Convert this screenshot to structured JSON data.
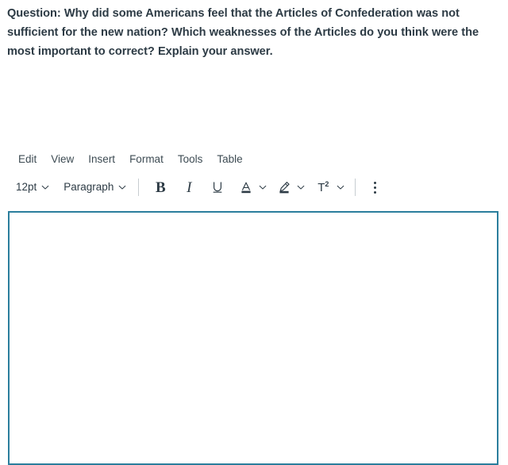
{
  "question": {
    "label": "question-prompt",
    "text": "Question:  Why did some Americans feel that the Articles of Confederation was not sufficient for the new nation?  Which weaknesses of the Articles do you think were the most important to correct?  Explain your answer."
  },
  "editor": {
    "menubar": {
      "items": [
        {
          "label": "Edit"
        },
        {
          "label": "View"
        },
        {
          "label": "Insert"
        },
        {
          "label": "Format"
        },
        {
          "label": "Tools"
        },
        {
          "label": "Table"
        }
      ]
    },
    "toolbar": {
      "font_size": {
        "value": "12pt",
        "icon": "chevron-down-icon"
      },
      "block_format": {
        "value": "Paragraph",
        "icon": "chevron-down-icon"
      },
      "bold": {
        "glyph": "B",
        "icon": "bold-icon"
      },
      "italic": {
        "glyph": "I",
        "icon": "italic-icon"
      },
      "underline": {
        "glyph": "U",
        "icon": "underline-icon"
      },
      "text_color": {
        "glyph": "A",
        "icon": "text-color-icon",
        "swatch": "#2d3b45"
      },
      "highlight": {
        "icon": "highlighter-icon",
        "swatch": "#2d3b45"
      },
      "superscript": {
        "glyph": "T",
        "exponent": "2",
        "icon": "superscript-icon"
      },
      "more": {
        "icon": "kebab-menu-icon"
      }
    },
    "content": {
      "value": "",
      "placeholder": ""
    },
    "focus_border_color": "#2b7e9d"
  },
  "colors": {
    "text_primary": "#2d3b45",
    "menu_text": "#3d4b53",
    "divider": "#c7cdd1",
    "accent": "#2b7e9d",
    "background": "#ffffff"
  }
}
